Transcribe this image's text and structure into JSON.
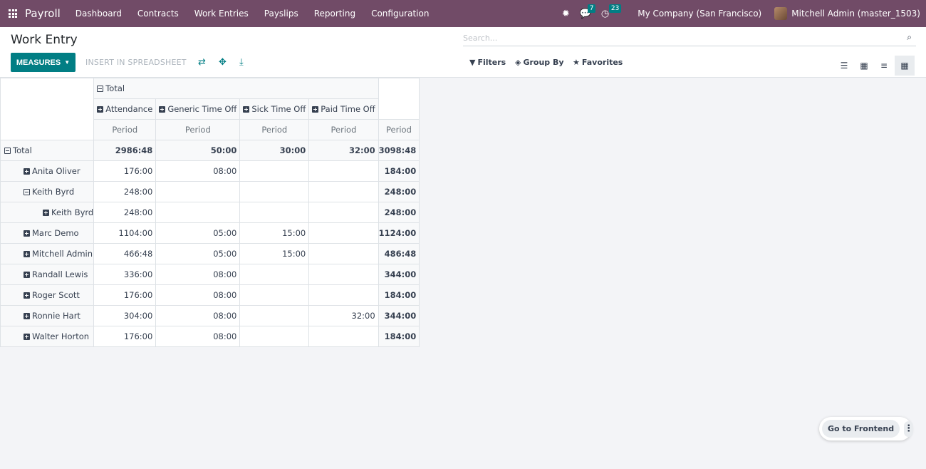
{
  "navbar": {
    "brand": "Payroll",
    "menu": [
      "Dashboard",
      "Contracts",
      "Work Entries",
      "Payslips",
      "Reporting",
      "Configuration"
    ],
    "messages_count": "7",
    "activities_count": "23",
    "company": "My Company (San Francisco)",
    "user": "Mitchell Admin (master_1503)"
  },
  "control": {
    "title": "Work Entry",
    "measures_label": "MEASURES",
    "insert_label": "INSERT IN SPREADSHEET",
    "search_placeholder": "Search...",
    "filters_label": "Filters",
    "groupby_label": "Group By",
    "favorites_label": "Favorites"
  },
  "pivot": {
    "col_total_label": "Total",
    "col_groups": [
      "Attendance",
      "Generic Time Off",
      "Sick Time Off",
      "Paid Time Off"
    ],
    "measure_label": "Period",
    "total_row": {
      "label": "Total",
      "values": [
        "2986:48",
        "50:00",
        "30:00",
        "32:00",
        "3098:48"
      ]
    },
    "rows": [
      {
        "label": "Anita Oliver",
        "values": [
          "176:00",
          "08:00",
          "",
          "",
          "184:00"
        ]
      },
      {
        "label": "Keith Byrd",
        "values": [
          "248:00",
          "",
          "",
          "",
          "248:00"
        ]
      },
      {
        "label": "Keith Byrd",
        "values": [
          "248:00",
          "",
          "",
          "",
          "248:00"
        ]
      },
      {
        "label": "Marc Demo",
        "values": [
          "1104:00",
          "05:00",
          "15:00",
          "",
          "1124:00"
        ]
      },
      {
        "label": "Mitchell Admin",
        "values": [
          "466:48",
          "05:00",
          "15:00",
          "",
          "486:48"
        ]
      },
      {
        "label": "Randall Lewis",
        "values": [
          "336:00",
          "08:00",
          "",
          "",
          "344:00"
        ]
      },
      {
        "label": "Roger Scott",
        "values": [
          "176:00",
          "08:00",
          "",
          "",
          "184:00"
        ]
      },
      {
        "label": "Ronnie Hart",
        "values": [
          "304:00",
          "08:00",
          "",
          "32:00",
          "344:00"
        ]
      },
      {
        "label": "Walter Horton",
        "values": [
          "176:00",
          "08:00",
          "",
          "",
          "184:00"
        ]
      }
    ]
  },
  "frontend": {
    "label": "Go to Frontend"
  }
}
